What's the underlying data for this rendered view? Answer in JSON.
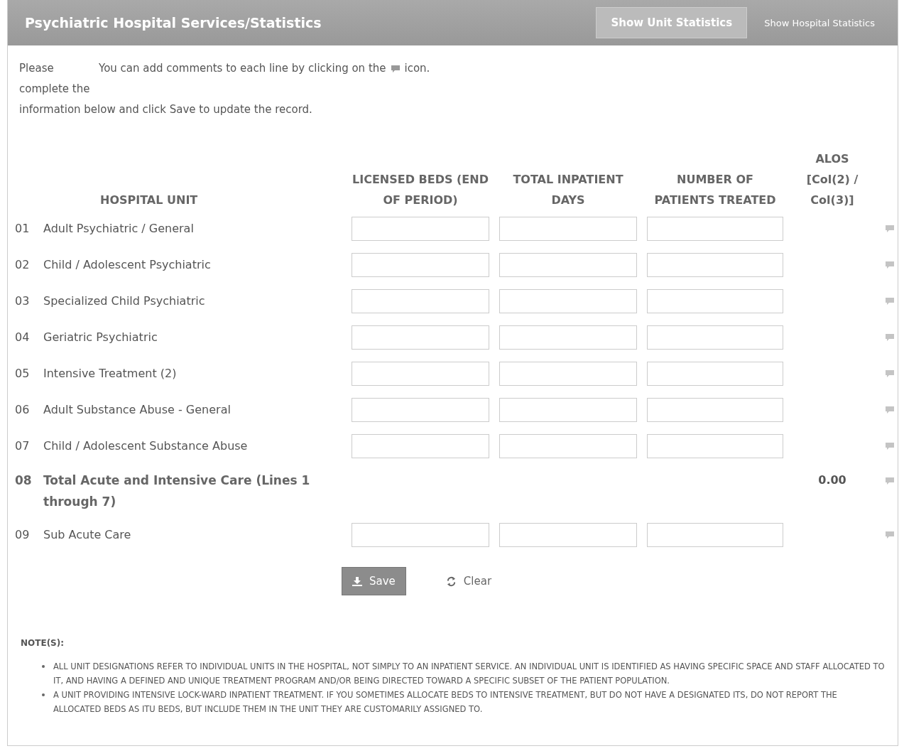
{
  "header": {
    "title": "Psychiatric Hospital Services/Statistics",
    "tabs": [
      {
        "label": "Show Unit Statistics",
        "selected": true
      },
      {
        "label": "Show Hospital Statistics",
        "selected": false
      }
    ]
  },
  "intro": {
    "lead": "Please complete the",
    "hint_before": "You can add comments to each line by clicking on the",
    "hint_after": "icon.",
    "tail": "information below and click Save to update the record."
  },
  "table": {
    "columns": [
      "HOSPITAL UNIT",
      "LICENSED BEDS (END OF PERIOD)",
      "TOTAL INPATIENT DAYS",
      "NUMBER OF PATIENTS TREATED",
      "ALOS [Col(2) / Col(3)]"
    ],
    "rows": [
      {
        "kind": "entry",
        "number": "01",
        "label": "Adult Psychiatric / General"
      },
      {
        "kind": "entry",
        "number": "02",
        "label": "Child / Adolescent Psychiatric"
      },
      {
        "kind": "entry",
        "number": "03",
        "label": "Specialized Child Psychiatric"
      },
      {
        "kind": "entry",
        "number": "04",
        "label": "Geriatric Psychiatric"
      },
      {
        "kind": "entry",
        "number": "05",
        "label": "Intensive Treatment (2)"
      },
      {
        "kind": "entry",
        "number": "06",
        "label": "Adult Substance Abuse - General"
      },
      {
        "kind": "entry",
        "number": "07",
        "label": "Child / Adolescent Substance Abuse"
      },
      {
        "kind": "total",
        "number": "08",
        "label": "Total Acute and Intensive Care (Lines 1 through 7)",
        "alos": "0.00"
      },
      {
        "kind": "entry",
        "number": "09",
        "label": "Sub Acute Care"
      }
    ]
  },
  "actions": {
    "save": "Save",
    "clear": "Clear"
  },
  "notes": {
    "title": "NOTE(S):",
    "items": [
      "ALL UNIT DESIGNATIONS REFER TO INDIVIDUAL UNITS IN THE HOSPITAL, NOT SIMPLY TO AN INPATIENT SERVICE. AN INDIVIDUAL UNIT IS IDENTIFIED AS HAVING SPECIFIC SPACE AND STAFF ALLOCATED TO IT, AND HAVING A DEFINED AND UNIQUE TREATMENT PROGRAM AND/OR BEING DIRECTED TOWARD A SPECIFIC SUBSET OF THE PATIENT POPULATION.",
      "A UNIT PROVIDING INTENSIVE LOCK-WARD INPATIENT TREATMENT. IF YOU SOMETIMES ALLOCATE BEDS TO INTENSIVE TREATMENT, BUT DO NOT HAVE A DESIGNATED ITS, DO NOT REPORT THE ALLOCATED BEDS AS ITU BEDS, BUT INCLUDE THEM IN THE UNIT THEY ARE CUSTOMARILY ASSIGNED TO."
    ]
  }
}
